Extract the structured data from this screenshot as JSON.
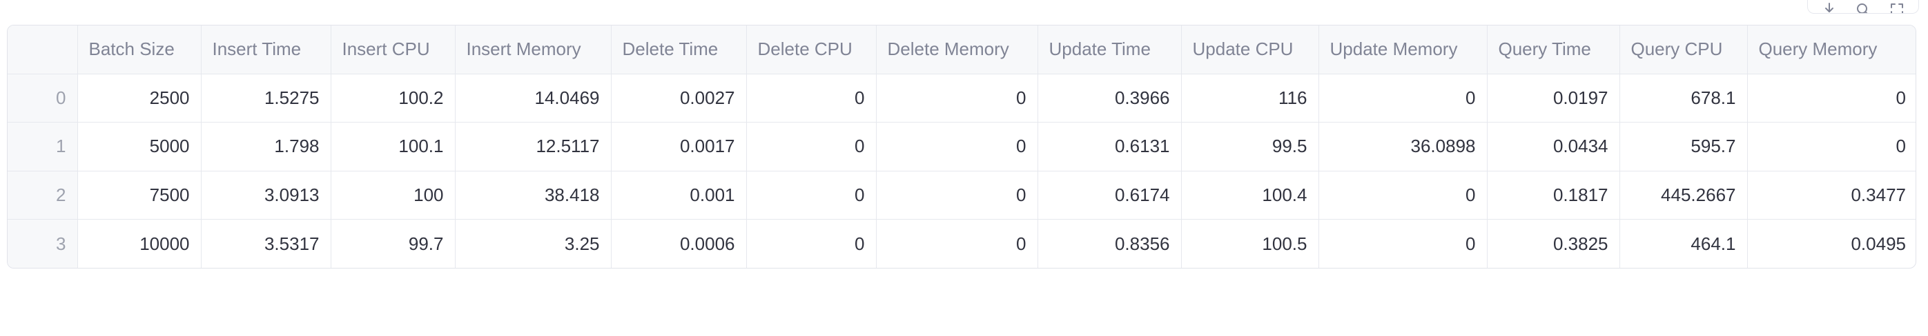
{
  "toolbar": {
    "icons": [
      "download-icon",
      "search-icon",
      "fullscreen-icon"
    ]
  },
  "table": {
    "index_header": "",
    "columns": [
      "Batch Size",
      "Insert Time",
      "Insert CPU",
      "Insert Memory",
      "Delete Time",
      "Delete CPU",
      "Delete Memory",
      "Update Time",
      "Update CPU",
      "Update Memory",
      "Query Time",
      "Query CPU",
      "Query Memory"
    ],
    "rows": [
      {
        "index": "0",
        "cells": [
          "2500",
          "1.5275",
          "100.2",
          "14.0469",
          "0.0027",
          "0",
          "0",
          "0.3966",
          "116",
          "0",
          "0.0197",
          "678.1",
          "0"
        ]
      },
      {
        "index": "1",
        "cells": [
          "5000",
          "1.798",
          "100.1",
          "12.5117",
          "0.0017",
          "0",
          "0",
          "0.6131",
          "99.5",
          "36.0898",
          "0.0434",
          "595.7",
          "0"
        ]
      },
      {
        "index": "2",
        "cells": [
          "7500",
          "3.0913",
          "100",
          "38.418",
          "0.001",
          "0",
          "0",
          "0.6174",
          "100.4",
          "0",
          "0.1817",
          "445.2667",
          "0.3477"
        ]
      },
      {
        "index": "3",
        "cells": [
          "10000",
          "3.5317",
          "99.7",
          "3.25",
          "0.0006",
          "0",
          "0",
          "0.8356",
          "100.5",
          "0",
          "0.3825",
          "464.1",
          "0.0495"
        ]
      }
    ]
  }
}
